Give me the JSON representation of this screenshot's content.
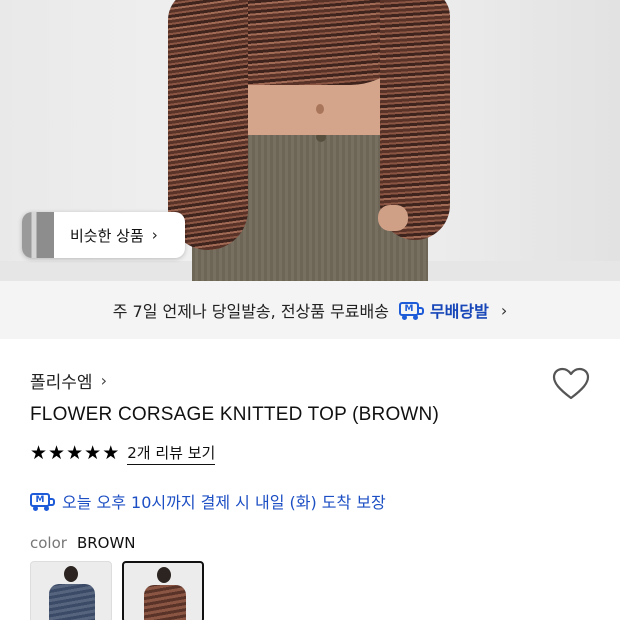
{
  "similar_products": {
    "label": "비슷한 상품",
    "chevron": "›"
  },
  "shipping_banner": {
    "text": "주 7일 언제나 당일발송, 전상품 무료배송",
    "brand": "무배당발",
    "logo_letter": "M",
    "chevron": "›"
  },
  "product": {
    "brand": "폴리수엠",
    "brand_chevron": "›",
    "title": "FLOWER CORSAGE KNITTED TOP (BROWN)",
    "rating_stars": 5,
    "reviews_label": "2개 리뷰 보기",
    "delivery_text": "오늘 오후 10시까지 결제 시 내일 (화) 도착 보장",
    "color_label": "color",
    "color_value": "BROWN"
  },
  "icons": {
    "heart": "heart-icon",
    "truck": "m-delivery-truck-icon",
    "star": "star-icon"
  },
  "colors": {
    "accent_blue": "#1d5bd8",
    "brand_blue": "#1746b8"
  }
}
